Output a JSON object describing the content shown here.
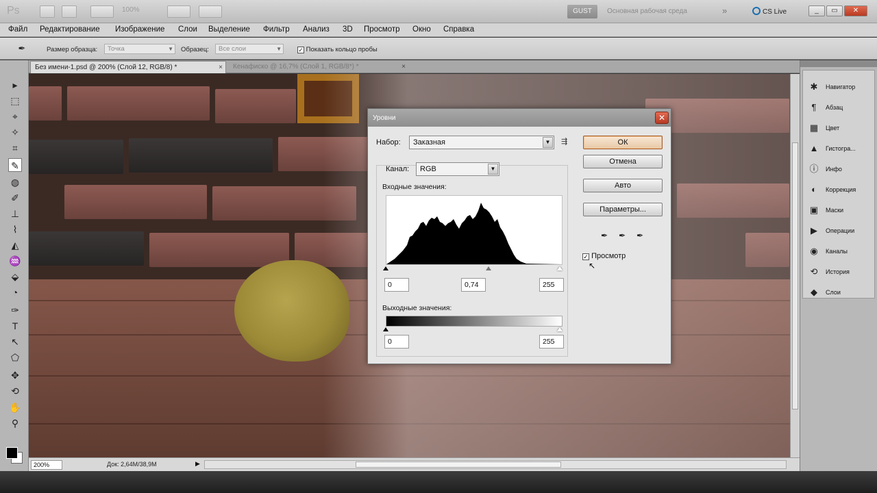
{
  "app": {
    "logo": "Ps",
    "zoom": "100%",
    "gust_label": "GUST",
    "workspace": "Основная рабочая среда",
    "more": "»",
    "cslive": "CS Live",
    "window_buttons": [
      "_",
      "▭",
      "✕"
    ]
  },
  "menu": [
    "Файл",
    "Редактирование",
    "Изображение",
    "Слои",
    "Выделение",
    "Фильтр",
    "Анализ",
    "3D",
    "Просмотр",
    "Окно",
    "Справка"
  ],
  "options": {
    "sample_size_label": "Размер образца:",
    "sample_size_value": "Точка",
    "sample_label": "Образец:",
    "sample_value": "Все слои",
    "show_ring_label": "Показать кольцо пробы",
    "show_ring_checked": "✓"
  },
  "tabs": [
    {
      "label": "Без имени-1.psd @ 200% (Слой 12, RGB/8) *",
      "close": "×"
    },
    {
      "label": "Кенафиско @ 16,7% (Слой 1, RGB/8*) *",
      "close": "×"
    }
  ],
  "tools": [
    "▸",
    "⬚",
    "⌖",
    "✧",
    "⌗",
    "✎",
    "◍",
    "✐",
    "⊥",
    "⌇",
    "◭",
    "♒",
    "⬙",
    "◔",
    "✑",
    "T",
    "↖",
    "⬠",
    "✥",
    "⟲",
    "✋",
    "⚲"
  ],
  "status": {
    "zoom": "200%",
    "doc_info": "Док: 2,64M/38,9M",
    "arrow": "▶"
  },
  "dock": [
    {
      "icon": "✱",
      "label": "Навигатор"
    },
    {
      "icon": "¶",
      "label": "Абзац"
    },
    {
      "icon": "▦",
      "label": "Цвет"
    },
    {
      "icon": "▲",
      "label": "Гистогра..."
    },
    {
      "icon": "ⓘ",
      "label": "Инфо"
    },
    {
      "icon": "◐",
      "label": "Коррекция"
    },
    {
      "icon": "▣",
      "label": "Маски"
    },
    {
      "icon": "▶",
      "label": "Операции"
    },
    {
      "icon": "◉",
      "label": "Каналы"
    },
    {
      "icon": "⟲",
      "label": "История"
    },
    {
      "icon": "◆",
      "label": "Слои"
    }
  ],
  "levels": {
    "title": "Уровни",
    "close": "✕",
    "preset_label": "Набор:",
    "preset_value": "Заказная",
    "preset_menu": "⇶",
    "channel_label": "Канал:",
    "channel_value": "RGB",
    "input_label": "Входные значения:",
    "input_black": "0",
    "input_gamma": "0,74",
    "input_white": "255",
    "output_label": "Выходные значения:",
    "output_black": "0",
    "output_white": "255",
    "ok": "ОК",
    "cancel": "Отмена",
    "auto": "Авто",
    "options": "Параметры...",
    "droppers": [
      "✒",
      "✒",
      "✒"
    ],
    "preview_label": "Просмотр",
    "preview_checked": "✓",
    "select_arrow": "▼"
  }
}
